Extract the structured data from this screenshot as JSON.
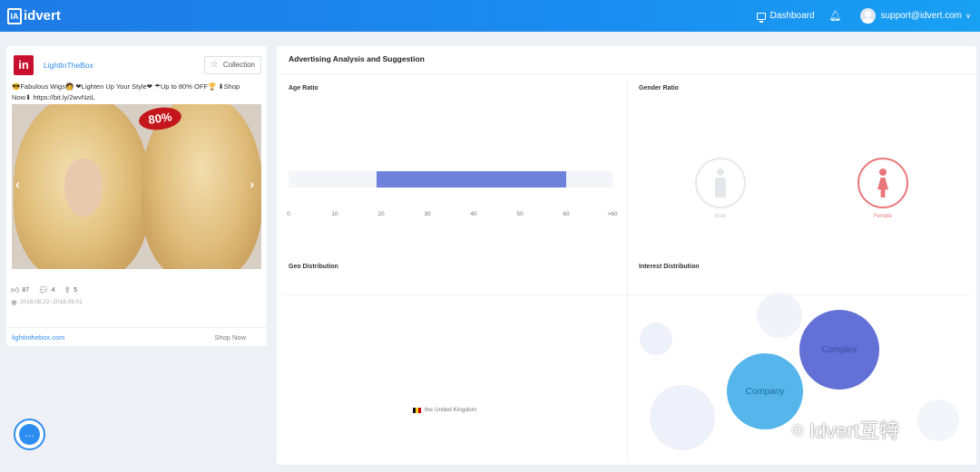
{
  "topbar": {
    "logo_mark": "IA",
    "logo_text": "idvert",
    "dashboard_label": "Dashboard",
    "user_email": "support@idvert.com",
    "icons": [
      "monitor-icon",
      "bell-icon",
      "avatar",
      "chevron-down-icon"
    ]
  },
  "ad": {
    "brand_logo": "in",
    "brand_name": "LightInTheBox",
    "collection_label": "Collection",
    "text_line1": "😎Fabulous Wigs🧑 ❤Lighten Up Your Style❤ ☂Up to 80% OFF🏆 ⬇Shop",
    "text_line2": "Now⬇ https://bit.ly/2wvNziL",
    "badge": "80%",
    "likes": "87",
    "comments": "4",
    "shares": "5",
    "date_range": "2018.08.22~2018.09.01",
    "link": "lightinthebox.com",
    "cta": "Shop Now"
  },
  "analysis": {
    "title": "Advertising Analysis and Suggestion",
    "age_title": "Age Ratio",
    "gender_title": "Gender Ratio",
    "geo_title": "Geo Distribution",
    "interest_title": "Interest Distribution",
    "age_ticks": [
      "0",
      "10",
      "20",
      "30",
      "40",
      "50",
      "60",
      ">60"
    ],
    "age_range": [
      19,
      60
    ],
    "age_axis_max": 70,
    "gender": {
      "male_label": "Male",
      "female_label": "Female",
      "selected": "female",
      "female_color": "#e8777a"
    },
    "geo": [
      "the United Kingdom"
    ],
    "interests": [
      "Complex",
      "Company"
    ]
  },
  "watermark": "Idvert互特",
  "colors": {
    "accent": "#2d8cf0",
    "age_bar": "#6e82dc",
    "complex": "#6370d6",
    "company": "#56b6ec"
  }
}
